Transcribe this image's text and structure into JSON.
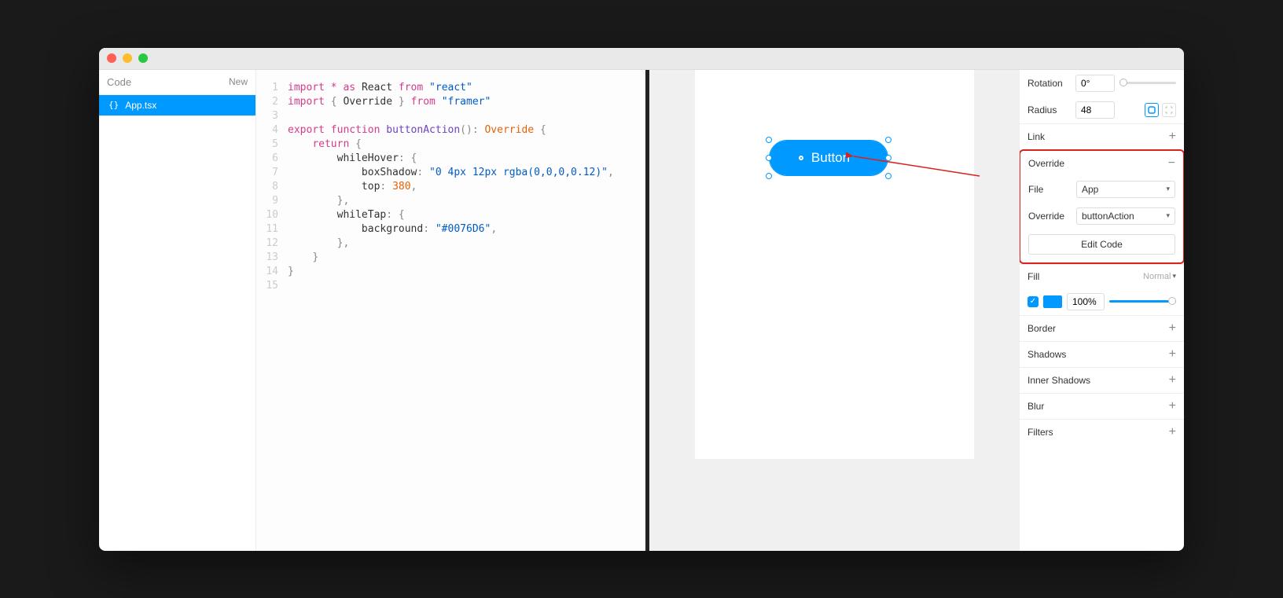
{
  "sidebar": {
    "title": "Code",
    "new_label": "New",
    "file_name": "App.tsx"
  },
  "code": {
    "line_numbers": [
      "1",
      "2",
      "3",
      "4",
      "5",
      "6",
      "7",
      "8",
      "9",
      "10",
      "11",
      "12",
      "13",
      "14",
      "15"
    ],
    "tokens": {
      "import": "import",
      "star": "*",
      "as": "as",
      "react_var": "React",
      "from": "from",
      "react_str": "\"react\"",
      "override_var": "Override",
      "framer_str": "\"framer\"",
      "export": "export",
      "function": "function",
      "func_name": "buttonAction",
      "override_type": "Override",
      "return": "return",
      "whileHover": "whileHover",
      "boxShadow": "boxShadow",
      "shadow_str": "\"0 4px 12px rgba(0,0,0,0.12)\"",
      "top": "top",
      "top_val": "380",
      "whileTap": "whileTap",
      "background": "background",
      "bg_str": "\"#0076D6\""
    }
  },
  "canvas": {
    "button_label": "Button"
  },
  "inspector": {
    "rotation_label": "Rotation",
    "rotation_value": "0°",
    "radius_label": "Radius",
    "radius_value": "48",
    "link_label": "Link",
    "override_label": "Override",
    "file_label": "File",
    "file_value": "App",
    "override_field_label": "Override",
    "override_value": "buttonAction",
    "edit_code_label": "Edit Code",
    "fill_label": "Fill",
    "fill_mode": "Normal",
    "fill_opacity": "100%",
    "border_label": "Border",
    "shadows_label": "Shadows",
    "inner_shadows_label": "Inner Shadows",
    "blur_label": "Blur",
    "filters_label": "Filters"
  }
}
